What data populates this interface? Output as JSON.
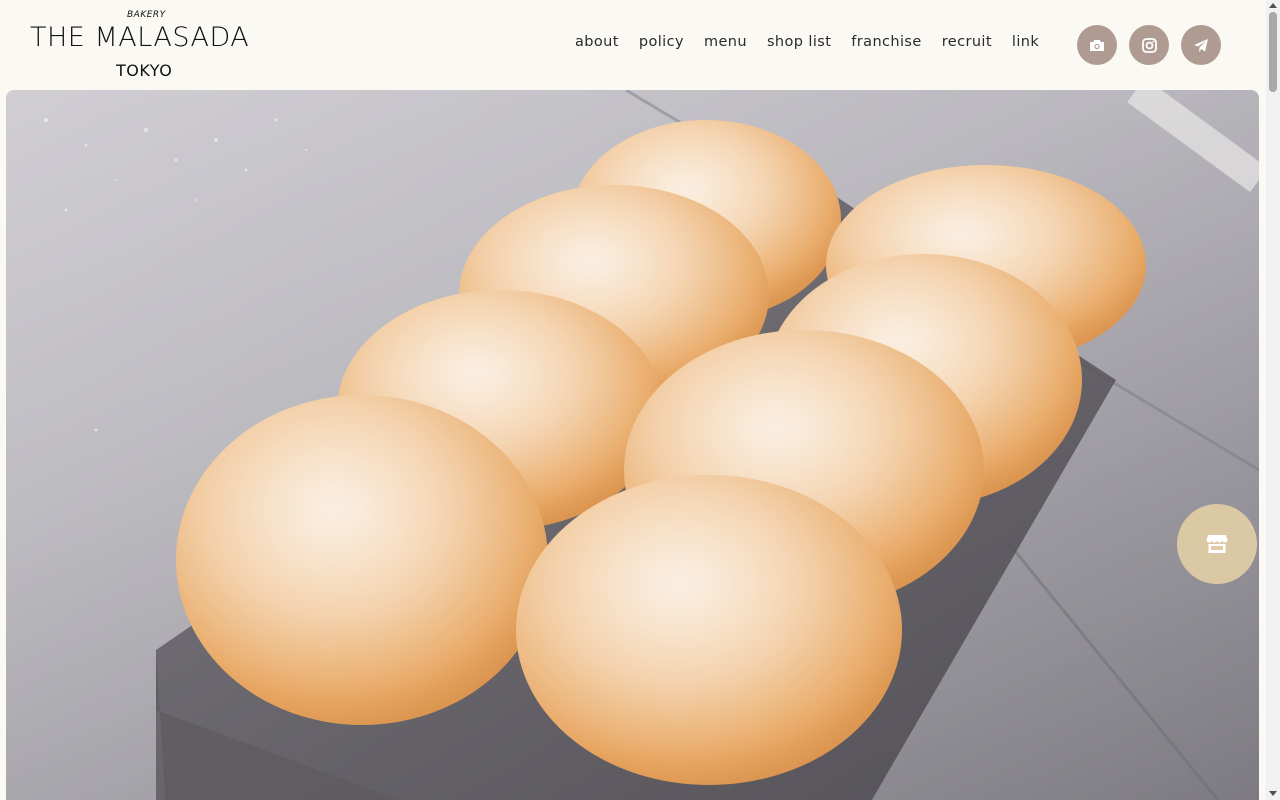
{
  "logo": {
    "top_text": "BAKERY",
    "main_text": "THE MALASADA",
    "sub_text": "TOKYO"
  },
  "nav": {
    "items": [
      {
        "label": "about"
      },
      {
        "label": "policy"
      },
      {
        "label": "menu"
      },
      {
        "label": "shop list"
      },
      {
        "label": "franchise"
      },
      {
        "label": "recruit"
      },
      {
        "label": "link"
      }
    ]
  },
  "social": {
    "buttons": [
      {
        "icon": "camera-icon"
      },
      {
        "icon": "instagram-icon"
      },
      {
        "icon": "paper-plane-icon"
      }
    ],
    "color": "#b09b93"
  },
  "hero": {
    "image": "sugar-coated-malasadas-on-metal-tray"
  },
  "floating_button": {
    "icon": "shop-icon",
    "color": "#e1cda5"
  }
}
